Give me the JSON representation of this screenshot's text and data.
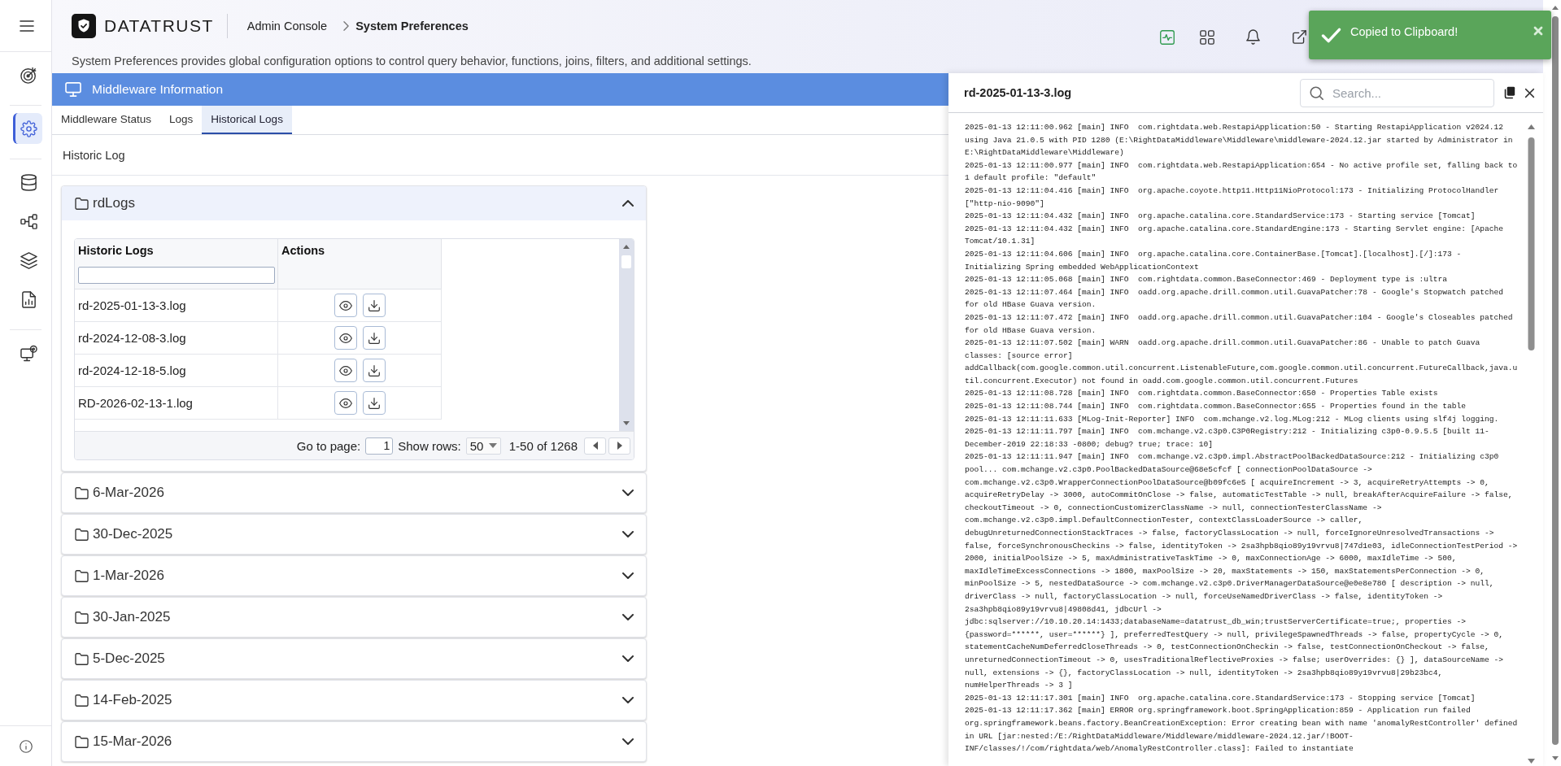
{
  "sidebar": {
    "groups": [
      {
        "items": [
          {
            "kind": "target",
            "selected": false
          }
        ]
      },
      {
        "items": [
          {
            "kind": "settings",
            "selected": true
          }
        ]
      },
      {
        "items": [
          {
            "kind": "database",
            "selected": false
          },
          {
            "kind": "flow",
            "selected": false
          },
          {
            "kind": "layers",
            "selected": false
          },
          {
            "kind": "report",
            "selected": false
          }
        ]
      },
      {
        "items": [
          {
            "kind": "monitor",
            "selected": false
          }
        ]
      }
    ]
  },
  "header": {
    "brand": "DATATRUST",
    "breadcrumb": [
      {
        "label": "Admin Console",
        "current": false
      },
      {
        "label": "System Preferences",
        "current": true
      }
    ],
    "description": "System Preferences provides global configuration options to control query behavior, functions, joins, filters, and additional settings."
  },
  "section": {
    "title": "Middleware Information",
    "tabs": [
      {
        "label": "Middleware Status",
        "selected": false
      },
      {
        "label": "Logs",
        "selected": false
      },
      {
        "label": "Historical Logs",
        "selected": true
      }
    ],
    "heading": "Historic Log",
    "folders": [
      {
        "name": "rdLogs",
        "expanded": true,
        "table": {
          "columns": [
            "Historic Logs",
            "Actions"
          ],
          "rows": [
            {
              "file": "rd-2025-01-13-3.log"
            },
            {
              "file": "rd-2024-12-08-3.log"
            },
            {
              "file": "rd-2024-12-18-5.log"
            },
            {
              "file": "RD-2026-02-13-1.log"
            }
          ],
          "pagination": {
            "go_to_label": "Go to page:",
            "page": "1",
            "rows_label": "Show rows:",
            "rows_per_page": "50",
            "range": "1-50 of 1268"
          }
        }
      },
      {
        "name": "6-Mar-2026",
        "expanded": false
      },
      {
        "name": "30-Dec-2025",
        "expanded": false
      },
      {
        "name": "1-Mar-2026",
        "expanded": false
      },
      {
        "name": "30-Jan-2025",
        "expanded": false
      },
      {
        "name": "5-Dec-2025",
        "expanded": false
      },
      {
        "name": "14-Feb-2025",
        "expanded": false
      },
      {
        "name": "15-Mar-2026",
        "expanded": false
      }
    ]
  },
  "log_panel": {
    "title": "rd-2025-01-13-3.log",
    "search": {
      "placeholder": "Search..."
    },
    "lines": [
      "2025-01-13 12:11:00.962 [main] INFO  com.rightdata.web.RestapiApplication:50 - Starting RestapiApplication v2024.12 using Java 21.0.5 with PID 1280 (E:\\RightDataMiddleware\\Middleware\\middleware-2024.12.jar started by Administrator in E:\\RightDataMiddleware\\Middleware)",
      "2025-01-13 12:11:00.977 [main] INFO  com.rightdata.web.RestapiApplication:654 - No active profile set, falling back to 1 default profile: \"default\"",
      "2025-01-13 12:11:04.416 [main] INFO  org.apache.coyote.http11.Http11NioProtocol:173 - Initializing ProtocolHandler [\"http-nio-9090\"]",
      "2025-01-13 12:11:04.432 [main] INFO  org.apache.catalina.core.StandardService:173 - Starting service [Tomcat]",
      "2025-01-13 12:11:04.432 [main] INFO  org.apache.catalina.core.StandardEngine:173 - Starting Servlet engine: [Apache Tomcat/10.1.31]",
      "2025-01-13 12:11:04.606 [main] INFO  org.apache.catalina.core.ContainerBase.[Tomcat].[localhost].[/]:173 - Initializing Spring embedded WebApplicationContext",
      "2025-01-13 12:11:05.068 [main] INFO  com.rightdata.common.BaseConnector:469 - Deployment type is :ultra",
      "2025-01-13 12:11:07.464 [main] INFO  oadd.org.apache.drill.common.util.GuavaPatcher:78 - Google's Stopwatch patched for old HBase Guava version.",
      "2025-01-13 12:11:07.472 [main] INFO  oadd.org.apache.drill.common.util.GuavaPatcher:104 - Google's Closeables patched for old HBase Guava version.",
      "2025-01-13 12:11:07.502 [main] WARN  oadd.org.apache.drill.common.util.GuavaPatcher:86 - Unable to patch Guava classes: [source error] addCallback(com.google.common.util.concurrent.ListenableFuture,com.google.common.util.concurrent.FutureCallback,java.util.concurrent.Executor) not found in oadd.com.google.common.util.concurrent.Futures",
      "2025-01-13 12:11:08.728 [main] INFO  com.rightdata.common.BaseConnector:650 - Properties Table exists",
      "2025-01-13 12:11:08.744 [main] INFO  com.rightdata.common.BaseConnector:655 - Properties found in the table",
      "2025-01-13 12:11:11.633 [MLog-Init-Reporter] INFO  com.mchange.v2.log.MLog:212 - MLog clients using slf4j logging.",
      "2025-01-13 12:11:11.797 [main] INFO  com.mchange.v2.c3p0.C3P0Registry:212 - Initializing c3p0-0.9.5.5 [built 11-December-2019 22:18:33 -0800; debug? true; trace: 10]",
      "2025-01-13 12:11:11.947 [main] INFO  com.mchange.v2.c3p0.impl.AbstractPoolBackedDataSource:212 - Initializing c3p0 pool... com.mchange.v2.c3p0.PoolBackedDataSource@68e5cfcf [ connectionPoolDataSource -> com.mchange.v2.c3p0.WrapperConnectionPoolDataSource@b09fc6e5 [ acquireIncrement -> 3, acquireRetryAttempts -> 0, acquireRetryDelay -> 3000, autoCommitOnClose -> false, automaticTestTable -> null, breakAfterAcquireFailure -> false, checkoutTimeout -> 0, connectionCustomizerClassName -> null, connectionTesterClassName -> com.mchange.v2.c3p0.impl.DefaultConnectionTester, contextClassLoaderSource -> caller, debugUnreturnedConnectionStackTraces -> false, factoryClassLocation -> null, forceIgnoreUnresolvedTransactions -> false, forceSynchronousCheckins -> false, identityToken -> 2sa3hpb8qio89y19vrvu8|747d1e03, idleConnectionTestPeriod -> 2000, initialPoolSize -> 5, maxAdministrativeTaskTime -> 0, maxConnectionAge -> 6000, maxIdleTime -> 500, maxIdleTimeExcessConnections -> 1800, maxPoolSize -> 20, maxStatements -> 150, maxStatementsPerConnection -> 0, minPoolSize -> 5, nestedDataSource -> com.mchange.v2.c3p0.DriverManagerDataSource@e0e8e780 [ description -> null, driverClass -> null, factoryClassLocation -> null, forceUseNamedDriverClass -> false, identityToken -> 2sa3hpb8qio89y19vrvu8|49808d41, jdbcUrl -> jdbc:sqlserver://10.10.20.14:1433;databaseName=datatrust_db_win;trustServerCertificate=true;, properties -> {password=******, user=******} ], preferredTestQuery -> null, privilegeSpawnedThreads -> false, propertyCycle -> 0, statementCacheNumDeferredCloseThreads -> 0, testConnectionOnCheckin -> false, testConnectionOnCheckout -> false, unreturnedConnectionTimeout -> 0, usesTraditionalReflectiveProxies -> false; userOverrides: {} ], dataSourceName -> null, extensions -> {}, factoryClassLocation -> null, identityToken -> 2sa3hpb8qio89y19vrvu8|29b23bc4, numHelperThreads -> 3 ]",
      "2025-01-13 12:11:17.301 [main] INFO  org.apache.catalina.core.StandardService:173 - Stopping service [Tomcat]",
      "2025-01-13 12:11:17.362 [main] ERROR org.springframework.boot.SpringApplication:859 - Application run failed org.springframework.beans.factory.BeanCreationException: Error creating bean with name 'anomalyRestController' defined in URL [jar:nested:/E:/RightDataMiddleware/Middleware/middleware-2024.12.jar/!BOOT-INF/classes/!/com/rightdata/web/AnomalyRestController.class]: Failed to instantiate"
    ]
  },
  "toast": {
    "message": "Copied to Clipboard!"
  }
}
